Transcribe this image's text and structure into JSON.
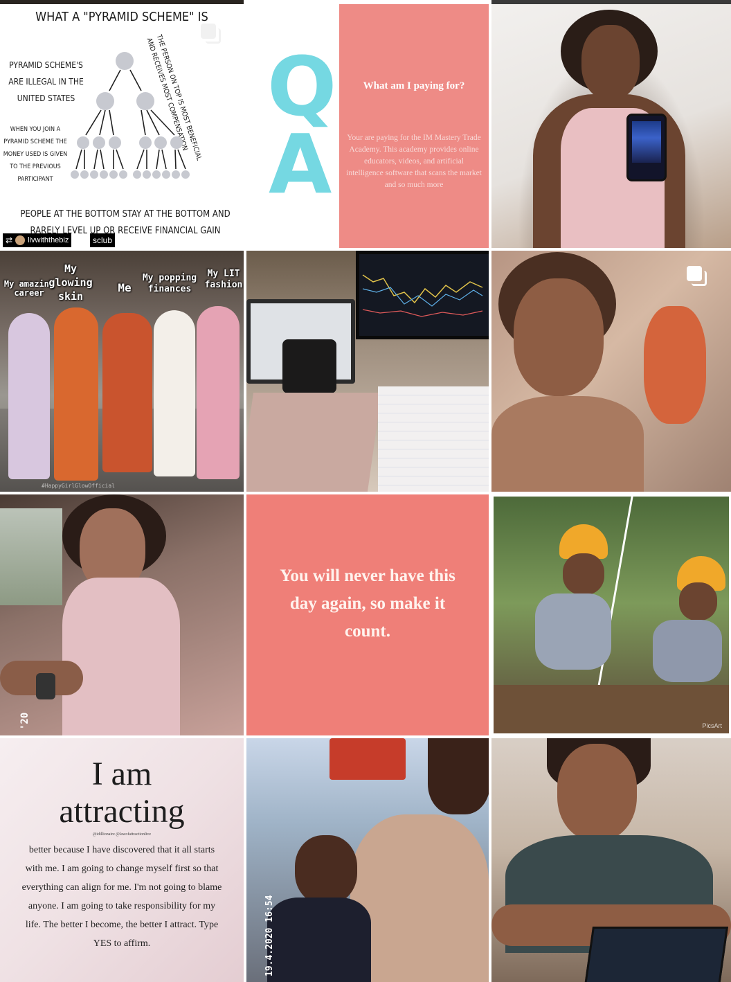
{
  "colors": {
    "qa_cyan": "#75d8e2",
    "qa_pink": "#ee8b86",
    "quote_pink": "#ef7f78"
  },
  "tiles": {
    "pyramid": {
      "title": "WHAT A \"PYRAMID SCHEME\" IS",
      "left_text_1": "PYRAMID SCHEME'S ARE ILLEGAL IN THE UNITED STATES",
      "left_text_2": "WHEN YOU JOIN A PYRAMID SCHEME THE MONEY USED IS GIVEN TO THE PREVIOUS PARTICIPANT",
      "right_text": "THE PERSON ON TOP IS MOST BENEFICIAL AND RECEIVES MOST COMPENSATION",
      "bottom_text": "PEOPLE AT THE BOTTOM STAY AT THE BOTTOM AND RARELY LEVEL UP OR RECEIVE FINANCIAL GAIN",
      "repost_user": "livwiththebiz",
      "repost_suffix": "sclub"
    },
    "qa": {
      "q": "Q",
      "a": "A",
      "title": "What am I paying for?",
      "body": "Your are paying for the IM Mastery Trade Academy. This academy provides online educators, videos, and artificial intelligence software that scans the market and so much more"
    },
    "meme": {
      "label_career": "My amazing career",
      "label_skin": "My glowing skin",
      "label_me": "Me",
      "label_finances": "My popping finances",
      "label_fashion": "My LIT fashion",
      "watermark": "#HappyGirlGlowOfficial"
    },
    "quote": {
      "text": "You will never have this day again, so make it count."
    },
    "zipline": {
      "watermark": "PicsArt"
    },
    "car_selfie": {
      "stamp": "'20"
    },
    "attracting": {
      "line1": "I am",
      "line2": "attracting",
      "handle": "@idillionaire @lawofattractionlive",
      "body": "better because I have discovered that it all starts with me. I am going to change myself first so that everything can align for me. I'm not going to blame anyone. I am going to take responsibility for my life. The better I become, the better I attract. Type YES to affirm."
    },
    "son_selfie": {
      "stamp": "19.4.2020 16:54"
    }
  }
}
